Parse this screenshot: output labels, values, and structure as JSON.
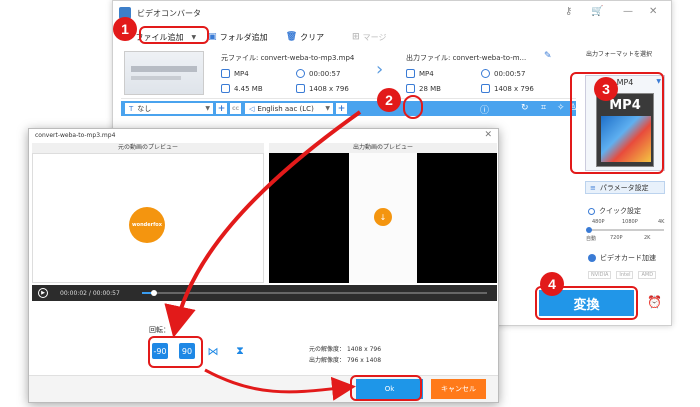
{
  "app": {
    "title": "ビデオコンバータ"
  },
  "toolbar": {
    "add_file": "ファイル追加",
    "add_folder": "フォルダ追加",
    "clear": "クリア",
    "merge": "マージ"
  },
  "file": {
    "source_name": "元ファイル: convert-weba-to-mp3.mp4",
    "output_name": "出力ファイル: convert-weba-to-m...",
    "src_format": "MP4",
    "src_duration": "00:00:57",
    "src_size": "4.45 MB",
    "src_resolution": "1408 x 796",
    "dst_format": "MP4",
    "dst_duration": "00:00:57",
    "dst_size": "28 MB",
    "dst_resolution": "1408 x 796"
  },
  "editbar": {
    "subtitle": "なし",
    "audio": "English aac (LC)"
  },
  "right_panel": {
    "title": "出力フォーマットを選択",
    "format": "MP4",
    "card_title": "MP4",
    "param_button": "パラメータ設定",
    "quick_settings": "クイック設定",
    "quality_top": [
      "480P",
      "1080P",
      "4K"
    ],
    "quality_bottom": [
      "自動",
      "720P",
      "2K"
    ],
    "gpu": "ビデオカード加速",
    "brands": [
      "NVIDIA",
      "Intel",
      "AMD"
    ],
    "convert": "変換"
  },
  "dialog": {
    "title": "convert-weba-to-mp3.mp4",
    "src_preview": "元の動画のプレビュー",
    "dst_preview": "出力動画のプレビュー",
    "logo_text": "wonderfox",
    "current_time": "00:00:02",
    "separator": "/",
    "total_time": "00:00:57",
    "progress": 0.035,
    "rotate_label": "回転：",
    "rotate_left": "-90",
    "rotate_right": "90",
    "orig_res_label": "元の解像度：",
    "orig_res": "1408 x 796",
    "out_res_label": "出力解像度：",
    "out_res": "796 x 1408",
    "ok": "Ok",
    "cancel": "キャンセル"
  },
  "annotations": [
    "1",
    "2",
    "3",
    "4"
  ],
  "colors": {
    "accent": "#1e96e8",
    "annotation": "#e21a1a",
    "cancel": "#ff7a1a",
    "logo": "#f4950f"
  }
}
